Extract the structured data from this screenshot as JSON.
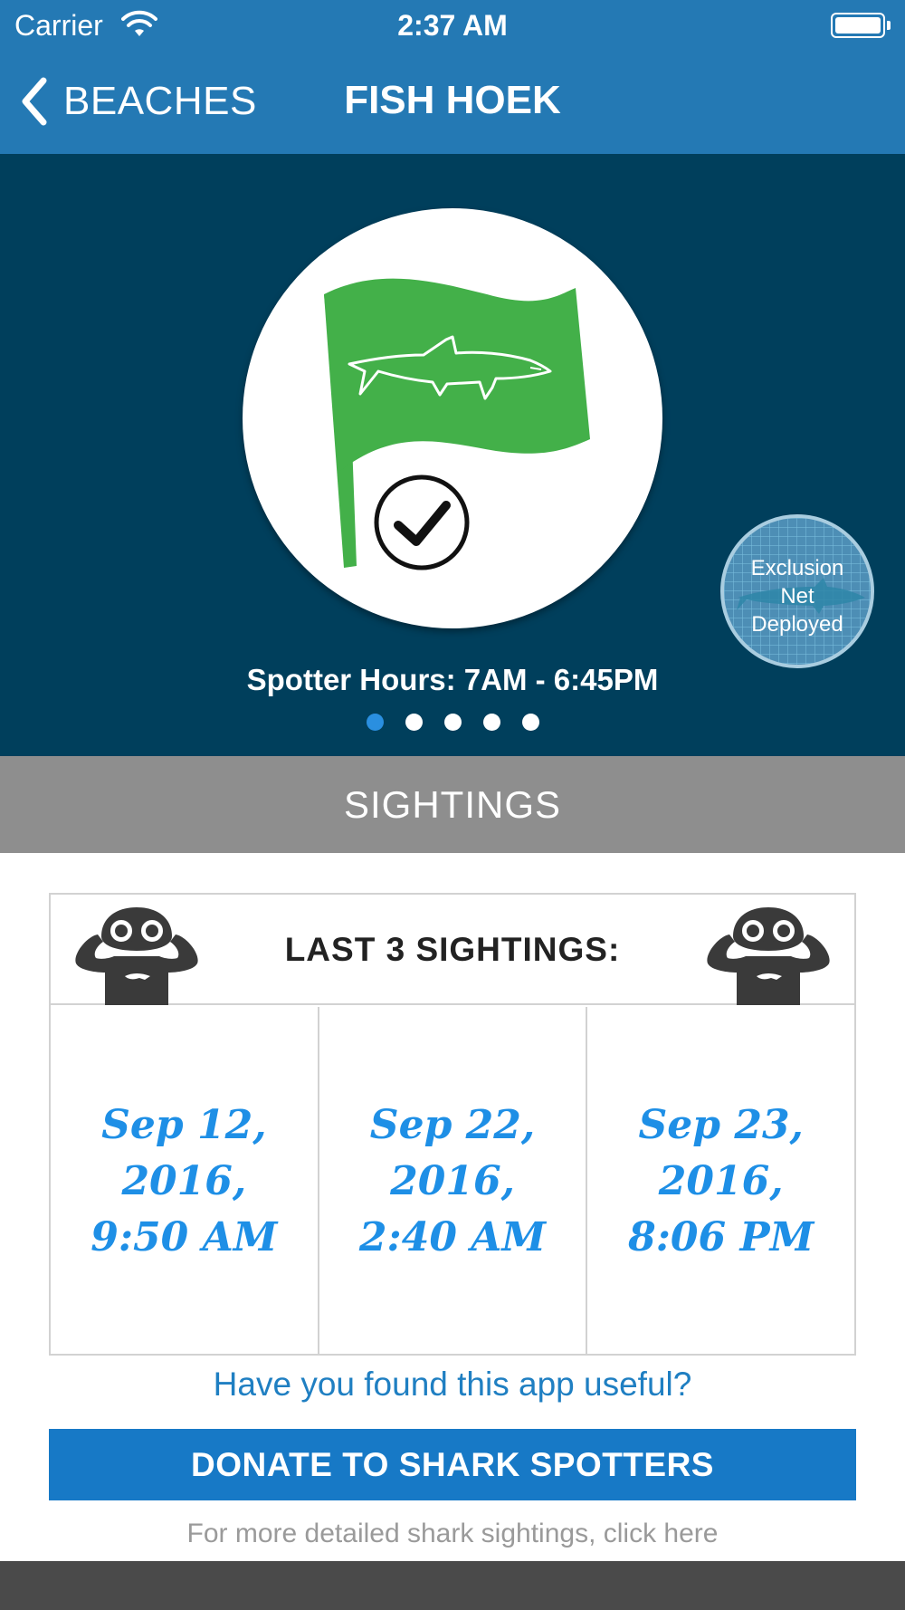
{
  "status_bar": {
    "carrier": "Carrier",
    "time": "2:37 AM"
  },
  "nav": {
    "back_label": "BEACHES",
    "title": "FISH HOEK"
  },
  "hero": {
    "flag_color": "#43b049",
    "flag_icon": "green-shark-flag-icon",
    "status_icon": "checkmark-circle-icon",
    "net_badge": {
      "line1": "Exclusion",
      "line2": "Net",
      "line3": "Deployed"
    },
    "spotter_hours": "Spotter Hours: 7AM - 6:45PM",
    "pager": {
      "count": 5,
      "active_index": 0
    }
  },
  "sightings_header": "SIGHTINGS",
  "sightings_box": {
    "title": "LAST 3 SIGHTINGS:",
    "entries": [
      {
        "line1": "Sep 12,",
        "line2": "2016,",
        "line3": "9:50 AM"
      },
      {
        "line1": "Sep 22,",
        "line2": "2016,",
        "line3": "2:40 AM"
      },
      {
        "line1": "Sep 23,",
        "line2": "2016,",
        "line3": "8:06 PM"
      }
    ]
  },
  "footer": {
    "question": "Have you found this app useful?",
    "donate_label": "DONATE TO SHARK SPOTTERS",
    "more_link": "For more detailed shark sightings, click here"
  },
  "colors": {
    "nav_blue": "#2479b4",
    "hero_bg": "#003f5c",
    "sightings_bar": "#8e8e8e",
    "date_blue": "#1e8fe6",
    "donate_blue": "#1779c6",
    "pager_active": "#2a8fe0"
  }
}
